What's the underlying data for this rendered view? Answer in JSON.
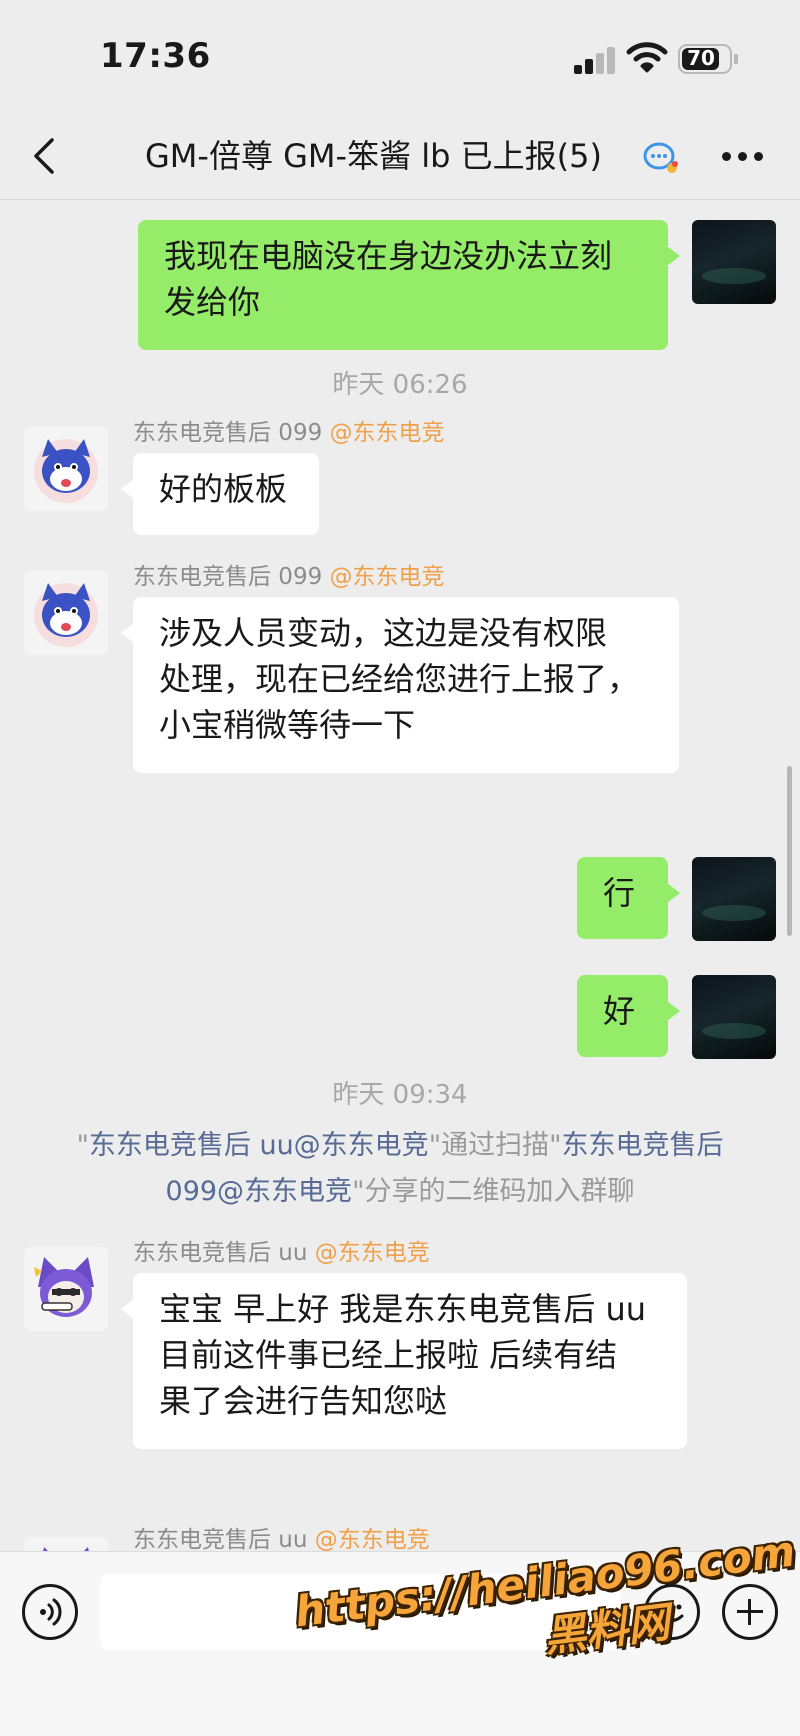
{
  "status_bar": {
    "time": "17:36",
    "battery": "70"
  },
  "nav": {
    "title": "GM-倍尊 GM-笨酱 lb 已上报(5)"
  },
  "messages": [
    {
      "side": "self",
      "text": "我现在电脑没在身边没办法立刻\n发给你"
    },
    {
      "type": "time",
      "text": "昨天 06:26"
    },
    {
      "side": "other",
      "sender": "东东电竞售后 099",
      "org": "@东东电竞",
      "text": "好的板板"
    },
    {
      "side": "other",
      "sender": "东东电竞售后 099",
      "org": "@东东电竞",
      "text": "涉及人员变动，这边是没有权限\n处理，现在已经给您进行上报了，\n小宝稍微等待一下"
    },
    {
      "side": "self",
      "text": "行"
    },
    {
      "side": "self",
      "text": "好"
    },
    {
      "type": "time",
      "text": "昨天 09:34"
    },
    {
      "type": "system",
      "parts": {
        "q1": "\"",
        "link1": "东东电竞售后 uu@东东电竞",
        "q2": "\"通过扫描\"",
        "link2a": "东东电竞售后",
        "link2b": "099@东东电竞",
        "tail": "\"分享的二维码加入群聊"
      }
    },
    {
      "side": "other",
      "sender": "东东电竞售后 uu",
      "org": "@东东电竞",
      "text": "宝宝 早上好 我是东东电竞售后 uu\n目前这件事已经上报啦 后续有结\n果了会进行告知您哒"
    },
    {
      "side": "other",
      "sender": "东东电竞售后 uu",
      "org": "@东东电竞",
      "text": ""
    }
  ],
  "watermark": {
    "url": "https://heiliao96.com",
    "name": "黑料网"
  },
  "colors": {
    "self_bubble": "#95ec69",
    "other_bubble": "#ffffff",
    "background": "#ededed",
    "org_tag": "#f0a048",
    "system_link": "#576b95"
  },
  "icons": {
    "back": "back-chevron-icon",
    "wechat_work": "wechat-work-icon",
    "more": "more-dots-icon",
    "voice": "voice-icon",
    "emoji": "emoji-icon",
    "plus": "plus-icon"
  }
}
